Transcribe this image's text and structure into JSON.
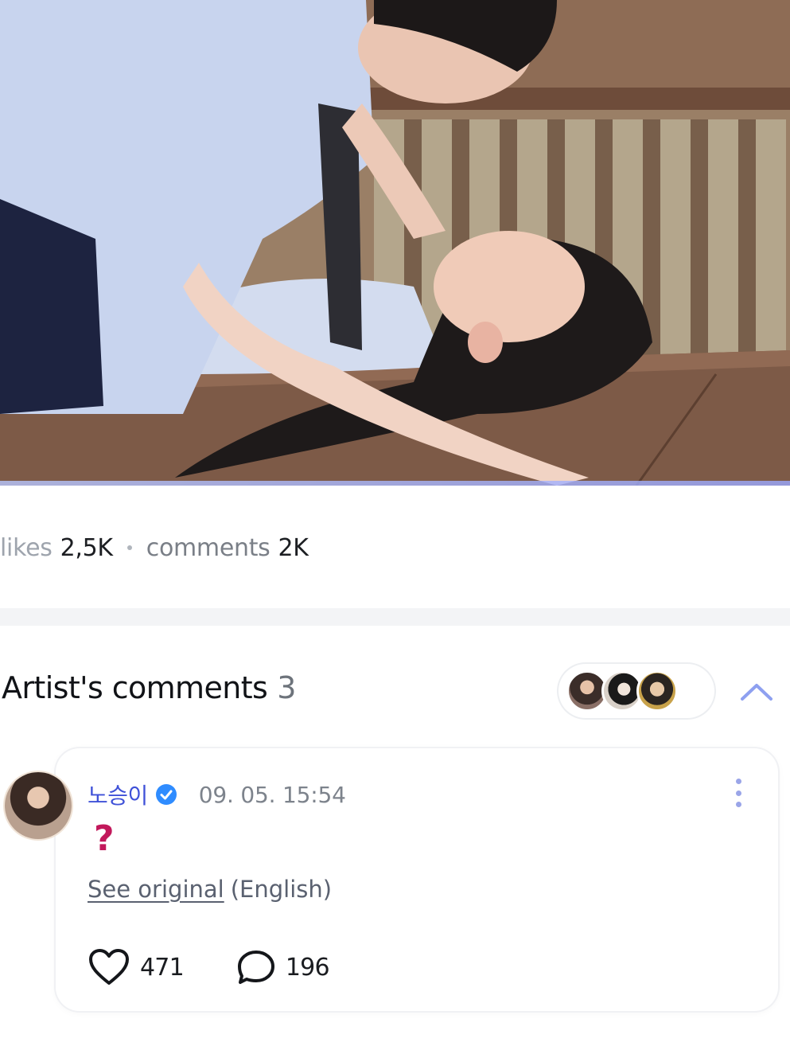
{
  "post": {
    "stats": {
      "likes_label": "likes",
      "likes_value": "2,5K",
      "comments_label": "comments",
      "comments_value": "2K"
    }
  },
  "artist_comments": {
    "title": "Artist's comments",
    "count": "3",
    "comment": {
      "author": "노승이",
      "timestamp": "09. 05. 15:54",
      "text": "?",
      "see_original": "See original",
      "language": "(English)",
      "likes": "471",
      "replies": "196"
    }
  },
  "colors": {
    "author": "#3f51d8",
    "verified": "#2f8cff",
    "question_mark": "#c2185b"
  },
  "icons": {
    "verified": "verified-badge-icon",
    "collapse": "chevron-up-icon",
    "more": "more-vertical-icon",
    "like": "heart-icon",
    "reply": "comment-bubble-icon"
  }
}
